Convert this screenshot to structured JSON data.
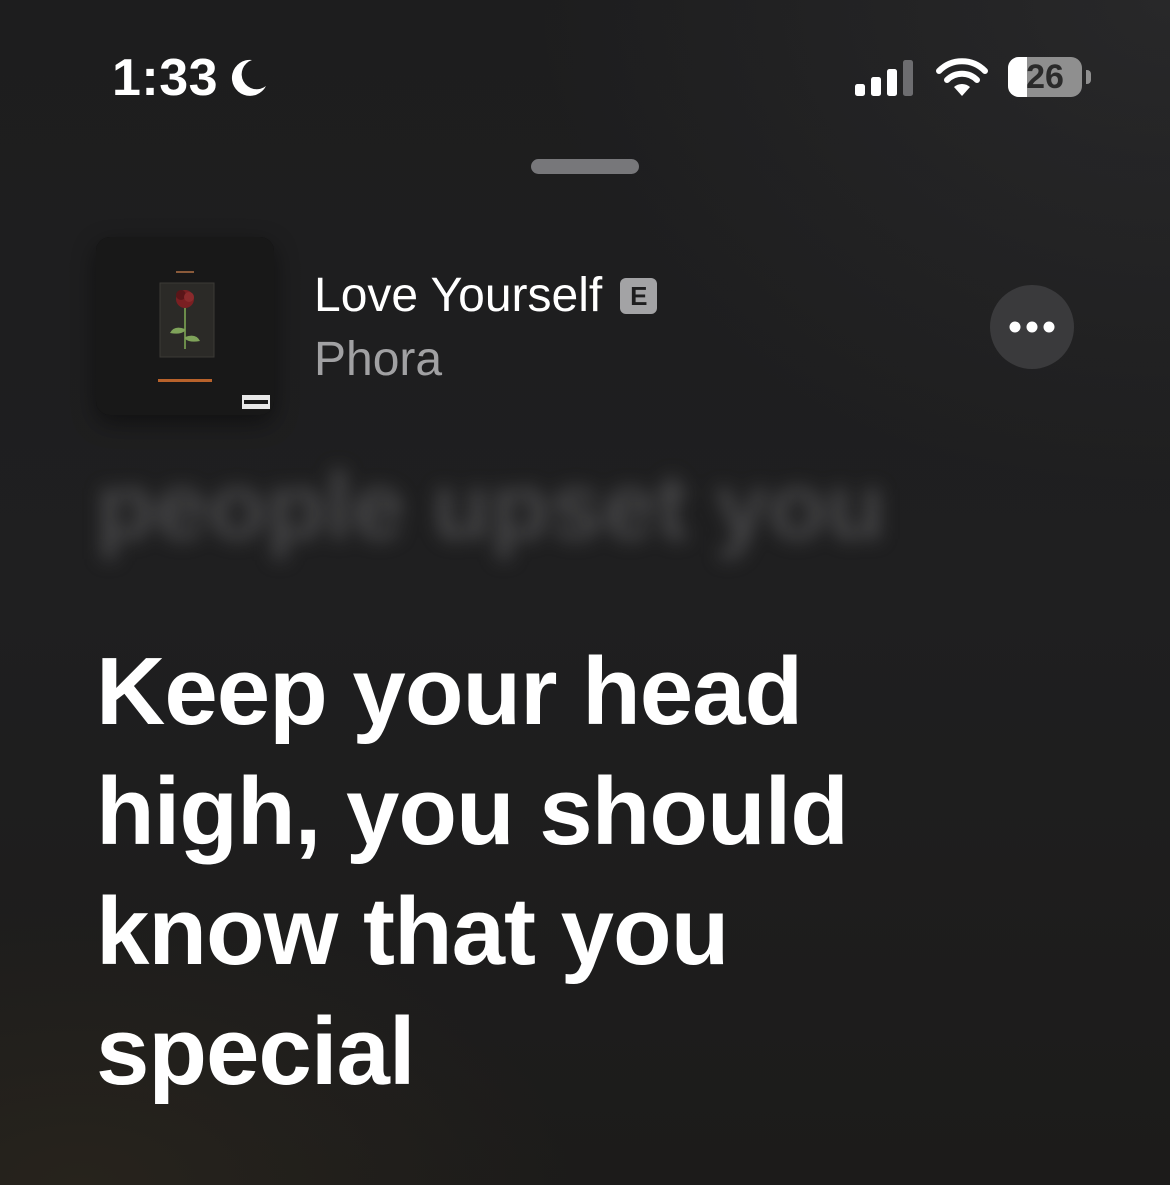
{
  "status_bar": {
    "time": "1:33",
    "focus_icon": "moon-icon",
    "signal_icon": "cellular-signal-icon",
    "wifi_icon": "wifi-icon",
    "battery_percent": "26",
    "battery_level": 0.26
  },
  "now_playing": {
    "title": "Love Yourself",
    "explicit_label": "E",
    "artist": "Phora",
    "more_icon": "ellipsis-icon",
    "artwork_icon": "album-artwork-rose"
  },
  "lyrics": {
    "previous_line": "people upset you",
    "current_line": "Keep your head high, you should know that you special"
  },
  "colors": {
    "background": "#1e1e1f",
    "primary_text": "#ffffff",
    "secondary_text": "#a1a1a3",
    "button_bg": "#3a3a3c"
  }
}
